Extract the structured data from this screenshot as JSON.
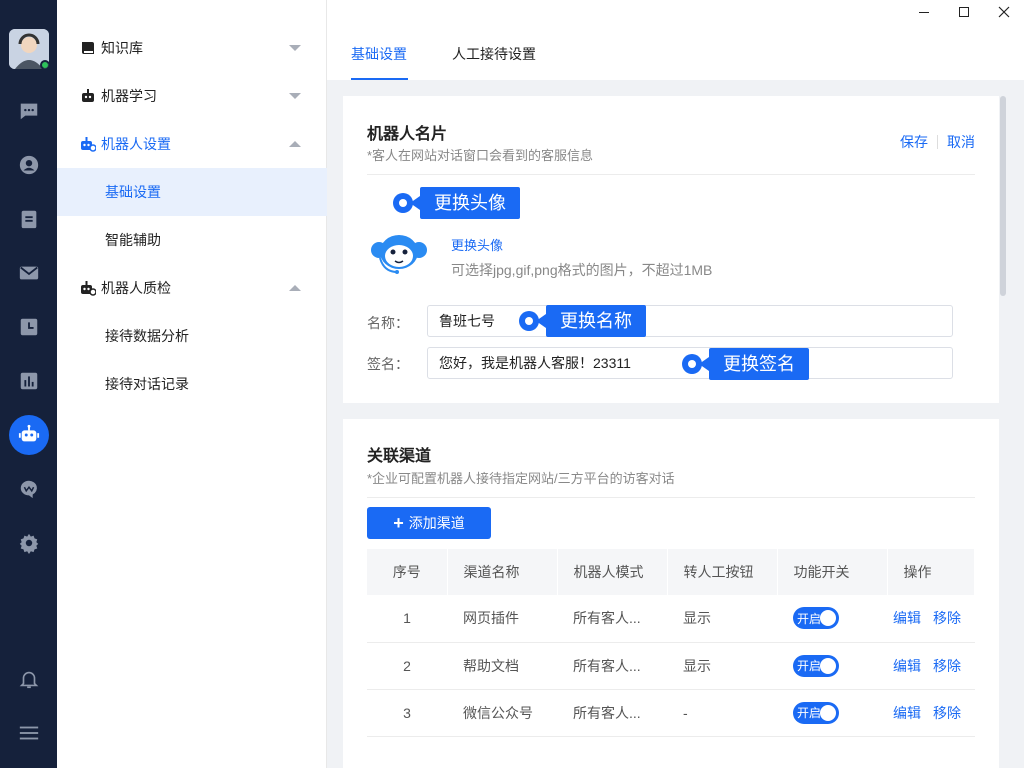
{
  "sidebar": {
    "items": [
      {
        "label": "知识库"
      },
      {
        "label": "机器学习"
      },
      {
        "label": "机器人设置"
      },
      {
        "label": "机器人质检"
      }
    ],
    "robot_sub": [
      {
        "label": "基础设置"
      },
      {
        "label": "智能辅助"
      }
    ],
    "qc_sub": [
      {
        "label": "接待数据分析"
      },
      {
        "label": "接待对话记录"
      }
    ]
  },
  "tabs": [
    {
      "label": "基础设置"
    },
    {
      "label": "人工接待设置"
    }
  ],
  "profile_card": {
    "title": "机器人名片",
    "desc": "*客人在网站对话窗口会看到的客服信息",
    "save": "保存",
    "cancel": "取消",
    "avatar_callout": "更换头像",
    "avatar_link": "更换头像",
    "avatar_hint": "可选择jpg,gif,png格式的图片，不超过1MB",
    "name_label": "名称：",
    "name_value": "鲁班七号",
    "name_callout": "更换名称",
    "sign_label": "签名：",
    "sign_value": "您好，我是机器人客服！23311",
    "sign_callout": "更换签名"
  },
  "channel_card": {
    "title": "关联渠道",
    "desc": "*企业可配置机器人接待指定网站/三方平台的访客对话",
    "add_button": "添加渠道",
    "columns": [
      "序号",
      "渠道名称",
      "机器人模式",
      "转人工按钮",
      "功能开关",
      "操作"
    ],
    "rows": [
      {
        "no": "1",
        "name": "网页插件",
        "mode": "所有客人...",
        "transfer": "显示",
        "switch": "开启",
        "edit": "编辑",
        "remove": "移除"
      },
      {
        "no": "2",
        "name": "帮助文档",
        "mode": "所有客人...",
        "transfer": "显示",
        "switch": "开启",
        "edit": "编辑",
        "remove": "移除"
      },
      {
        "no": "3",
        "name": "微信公众号",
        "mode": "所有客人...",
        "transfer": "-",
        "switch": "开启",
        "edit": "编辑",
        "remove": "移除"
      }
    ]
  },
  "colors": {
    "accent": "#1a6af4",
    "rail": "#15213b"
  }
}
